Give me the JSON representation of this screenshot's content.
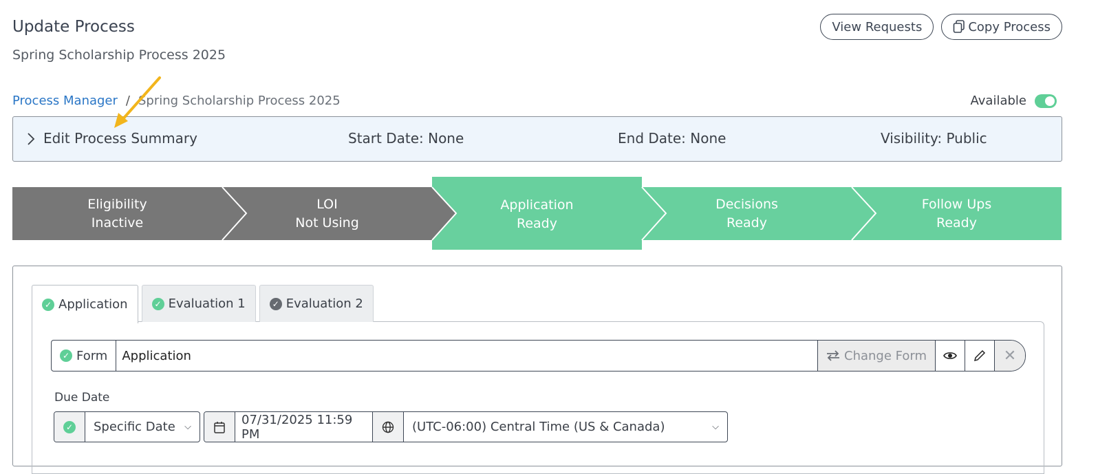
{
  "header": {
    "title": "Update Process",
    "subtitle": "Spring Scholarship Process 2025",
    "view_requests_label": "View Requests",
    "copy_process_label": "Copy Process"
  },
  "breadcrumb": {
    "root": "Process Manager",
    "separator": "/",
    "current": "Spring Scholarship Process 2025"
  },
  "availability": {
    "label": "Available",
    "enabled": true
  },
  "summary": {
    "toggle_label": "Edit Process Summary",
    "start_date": "Start Date: None",
    "end_date": "End Date: None",
    "visibility": "Visibility: Public"
  },
  "steps": [
    {
      "name": "Eligibility",
      "status": "Inactive",
      "state": "inactive"
    },
    {
      "name": "LOI",
      "status": "Not Using",
      "state": "inactive"
    },
    {
      "name": "Application",
      "status": "Ready",
      "state": "active"
    },
    {
      "name": "Decisions",
      "status": "Ready",
      "state": "ready"
    },
    {
      "name": "Follow Ups",
      "status": "Ready",
      "state": "ready"
    }
  ],
  "tabs": [
    {
      "label": "Application",
      "active": true,
      "check": "green"
    },
    {
      "label": "Evaluation 1",
      "active": false,
      "check": "green"
    },
    {
      "label": "Evaluation 2",
      "active": false,
      "check": "gray"
    }
  ],
  "form": {
    "label": "Form",
    "value": "Application",
    "change_label": "Change Form"
  },
  "due_date": {
    "label": "Due Date",
    "type_value": "Specific Date",
    "date_value": "07/31/2025 11:59 PM",
    "timezone_value": "(UTC-06:00) Central Time (US & Canada)"
  },
  "colors": {
    "accent_green": "#68d09e",
    "inactive_gray": "#777777",
    "link_blue": "#2a76c6",
    "annotation_arrow": "#f2b51c"
  }
}
